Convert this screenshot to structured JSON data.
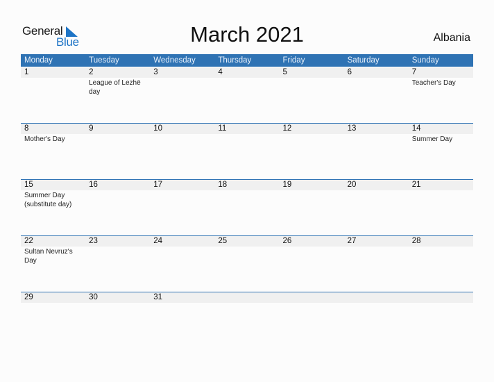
{
  "logo": {
    "text_general": "General",
    "text_blue": "Blue",
    "accent": "#1d74c6"
  },
  "title": "March 2021",
  "country": "Albania",
  "colors": {
    "header_bg": "#2f73b4",
    "strip_bg": "#f0f0f0"
  },
  "weekdays": [
    "Monday",
    "Tuesday",
    "Wednesday",
    "Thursday",
    "Friday",
    "Saturday",
    "Sunday"
  ],
  "weeks": [
    {
      "days": [
        "1",
        "2",
        "3",
        "4",
        "5",
        "6",
        "7"
      ],
      "events": [
        "",
        "League of Lezhë day",
        "",
        "",
        "",
        "",
        "Teacher's Day"
      ]
    },
    {
      "days": [
        "8",
        "9",
        "10",
        "11",
        "12",
        "13",
        "14"
      ],
      "events": [
        "Mother's Day",
        "",
        "",
        "",
        "",
        "",
        "Summer Day"
      ]
    },
    {
      "days": [
        "15",
        "16",
        "17",
        "18",
        "19",
        "20",
        "21"
      ],
      "events": [
        "Summer Day (substitute day)",
        "",
        "",
        "",
        "",
        "",
        ""
      ]
    },
    {
      "days": [
        "22",
        "23",
        "24",
        "25",
        "26",
        "27",
        "28"
      ],
      "events": [
        "Sultan Nevruz's Day",
        "",
        "",
        "",
        "",
        "",
        ""
      ]
    },
    {
      "days": [
        "29",
        "30",
        "31",
        "",
        "",
        "",
        ""
      ],
      "events": [
        "",
        "",
        "",
        "",
        "",
        "",
        ""
      ]
    }
  ]
}
